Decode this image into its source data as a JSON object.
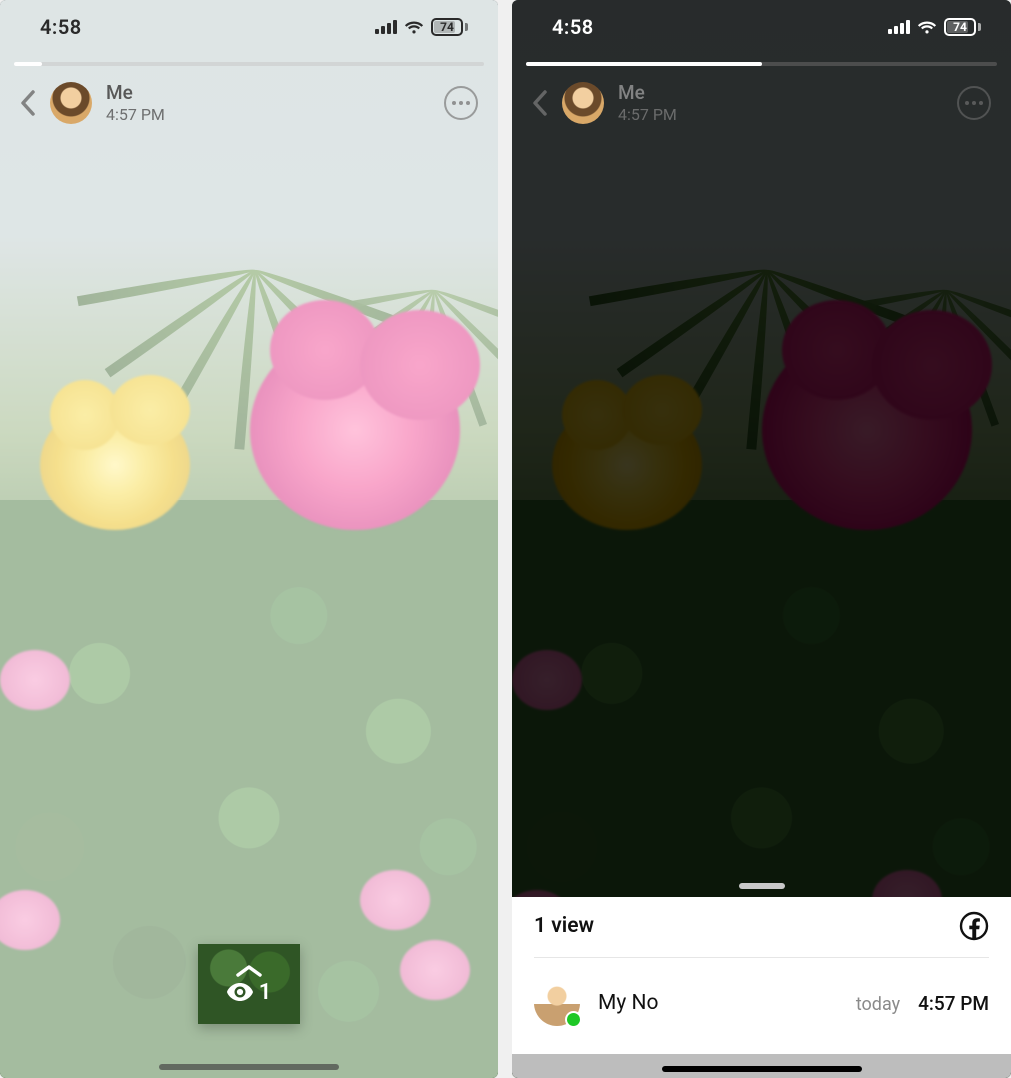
{
  "status": {
    "time": "4:58",
    "battery_pct": "74"
  },
  "story": {
    "author": "Me",
    "posted_time": "4:57 PM",
    "progress_left_pct": 6,
    "progress_right_pct": 50
  },
  "left": {
    "views_count": "1"
  },
  "right": {
    "sheet_title": "1 view",
    "viewer": {
      "name": "My No",
      "day": "today",
      "time": "4:57 PM"
    }
  },
  "icons": {
    "signal": "signal-icon",
    "wifi": "wifi-icon",
    "battery": "battery-icon",
    "back": "chevron-left-icon",
    "more": "more-horizontal-icon",
    "chevron_up": "chevron-up-icon",
    "eye": "eye-icon",
    "facebook": "facebook-icon",
    "sheet_handle": "drag-handle-icon",
    "presence": "presence-dot-icon"
  }
}
